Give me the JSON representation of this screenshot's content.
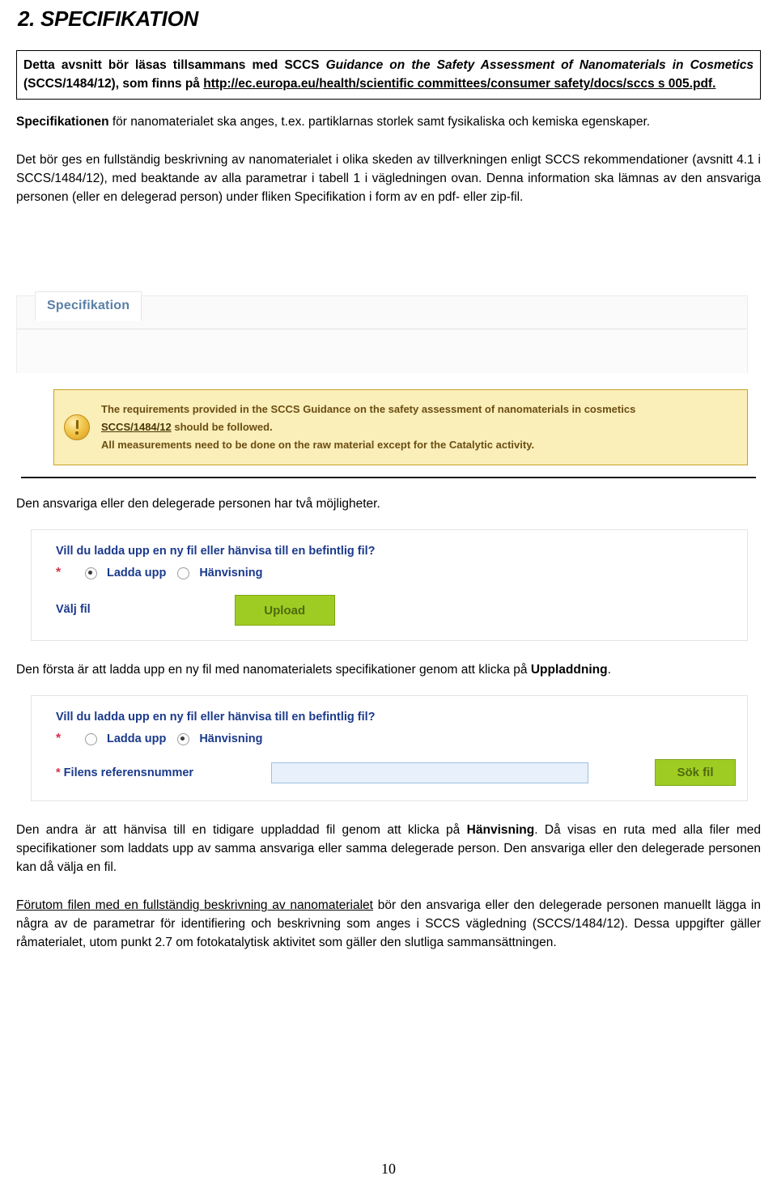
{
  "document": {
    "heading": "2. SPECIFIKATION",
    "page_number": "10"
  },
  "intro_box": {
    "line1_plain_a": "Detta avsnitt bör läsas tillsammans med SCCS ",
    "line1_italic": "Guidance on the Safety Assessment of Nanomaterials in Cosmetics",
    "line1_plain_b": " (SCCS/1484/12), som finns på ",
    "link": "http://ec.europa.eu/health/scientific committees/consumer safety/docs/sccs s 005.pdf."
  },
  "paragraphs": {
    "p1_bold": "Specifikationen",
    "p1_rest": " för nanomaterialet ska anges, t.ex. partiklarnas storlek samt fysikaliska och kemiska egenskaper.",
    "p2": "Det bör ges en fullständig beskrivning av nanomaterialet i olika skeden av tillverkningen enligt SCCS rekommendationer (avsnitt 4.1 i SCCS/1484/12), med beaktande av alla parametrar i tabell 1 i vägledningen ovan. Denna information ska lämnas av den ansvariga personen (eller en delegerad person) under fliken Specifikation i form av en pdf- eller zip-fil.",
    "p3": "Den ansvariga eller den delegerade personen har två möjligheter.",
    "p4_a": "Den första är att ladda upp en ny fil med nanomaterialets specifikationer genom att klicka på ",
    "p4_bold": "Uppladdning",
    "p4_b": ".",
    "p5_a": "Den andra är att hänvisa till en tidigare uppladdad fil genom att klicka på ",
    "p5_bold": "Hänvisning",
    "p5_b": ". Då visas en ruta med alla filer med specifikationer som laddats upp av samma ansvariga eller samma delegerade person. Den ansvariga eller den delegerade personen kan då välja en fil.",
    "p6_underline": "Förutom filen med en fullständig beskrivning av nanomaterialet",
    "p6_rest": " bör den ansvariga eller den delegerade personen manuellt lägga in några av de parametrar för identifiering och beskrivning som anges i SCCS vägledning (SCCS/1484/12). Dessa uppgifter gäller råmaterialet, utom punkt 2.7 om fotokatalytisk aktivitet som gäller den slutliga sammansättningen."
  },
  "screenshot_tabs": {
    "active_tab_label": "Specifikation"
  },
  "screenshot_warning": {
    "icon": "warning-exclamation-icon",
    "line1": "The requirements provided in the SCCS Guidance on the safety assessment of nanomaterials in cosmetics",
    "line2_link": "SCCS/1484/12",
    "line2_rest": " should be followed.",
    "line3": "All measurements need to be done on the raw material except for the Catalytic activity.",
    "bg_color": "#faeeb9",
    "border_color": "#c9a227",
    "text_color": "#6b4e12"
  },
  "screenshot_upload_form": {
    "question": "Vill du ladda upp en ny fil eller hänvisa till en befintlig fil?",
    "required_marker": "*",
    "radio_upload_label": "Ladda upp",
    "radio_upload_selected": true,
    "radio_reference_label": "Hänvisning",
    "radio_reference_selected": false,
    "file_label": "Välj fil",
    "button_label": "Upload",
    "button_color": "#9fcc22"
  },
  "screenshot_reference_form": {
    "question": "Vill du ladda upp en ny fil eller hänvisa till en befintlig fil?",
    "required_marker": "*",
    "radio_upload_label": "Ladda upp",
    "radio_upload_selected": false,
    "radio_reference_label": "Hänvisning",
    "radio_reference_selected": true,
    "ref_star": "*",
    "ref_label": " Filens referensnummer",
    "ref_value": "",
    "ref_placeholder": "",
    "button_label": "Sök fil",
    "button_color": "#9fcc22",
    "input_bg": "#e8f0fb",
    "input_border": "#9cc0e4"
  }
}
